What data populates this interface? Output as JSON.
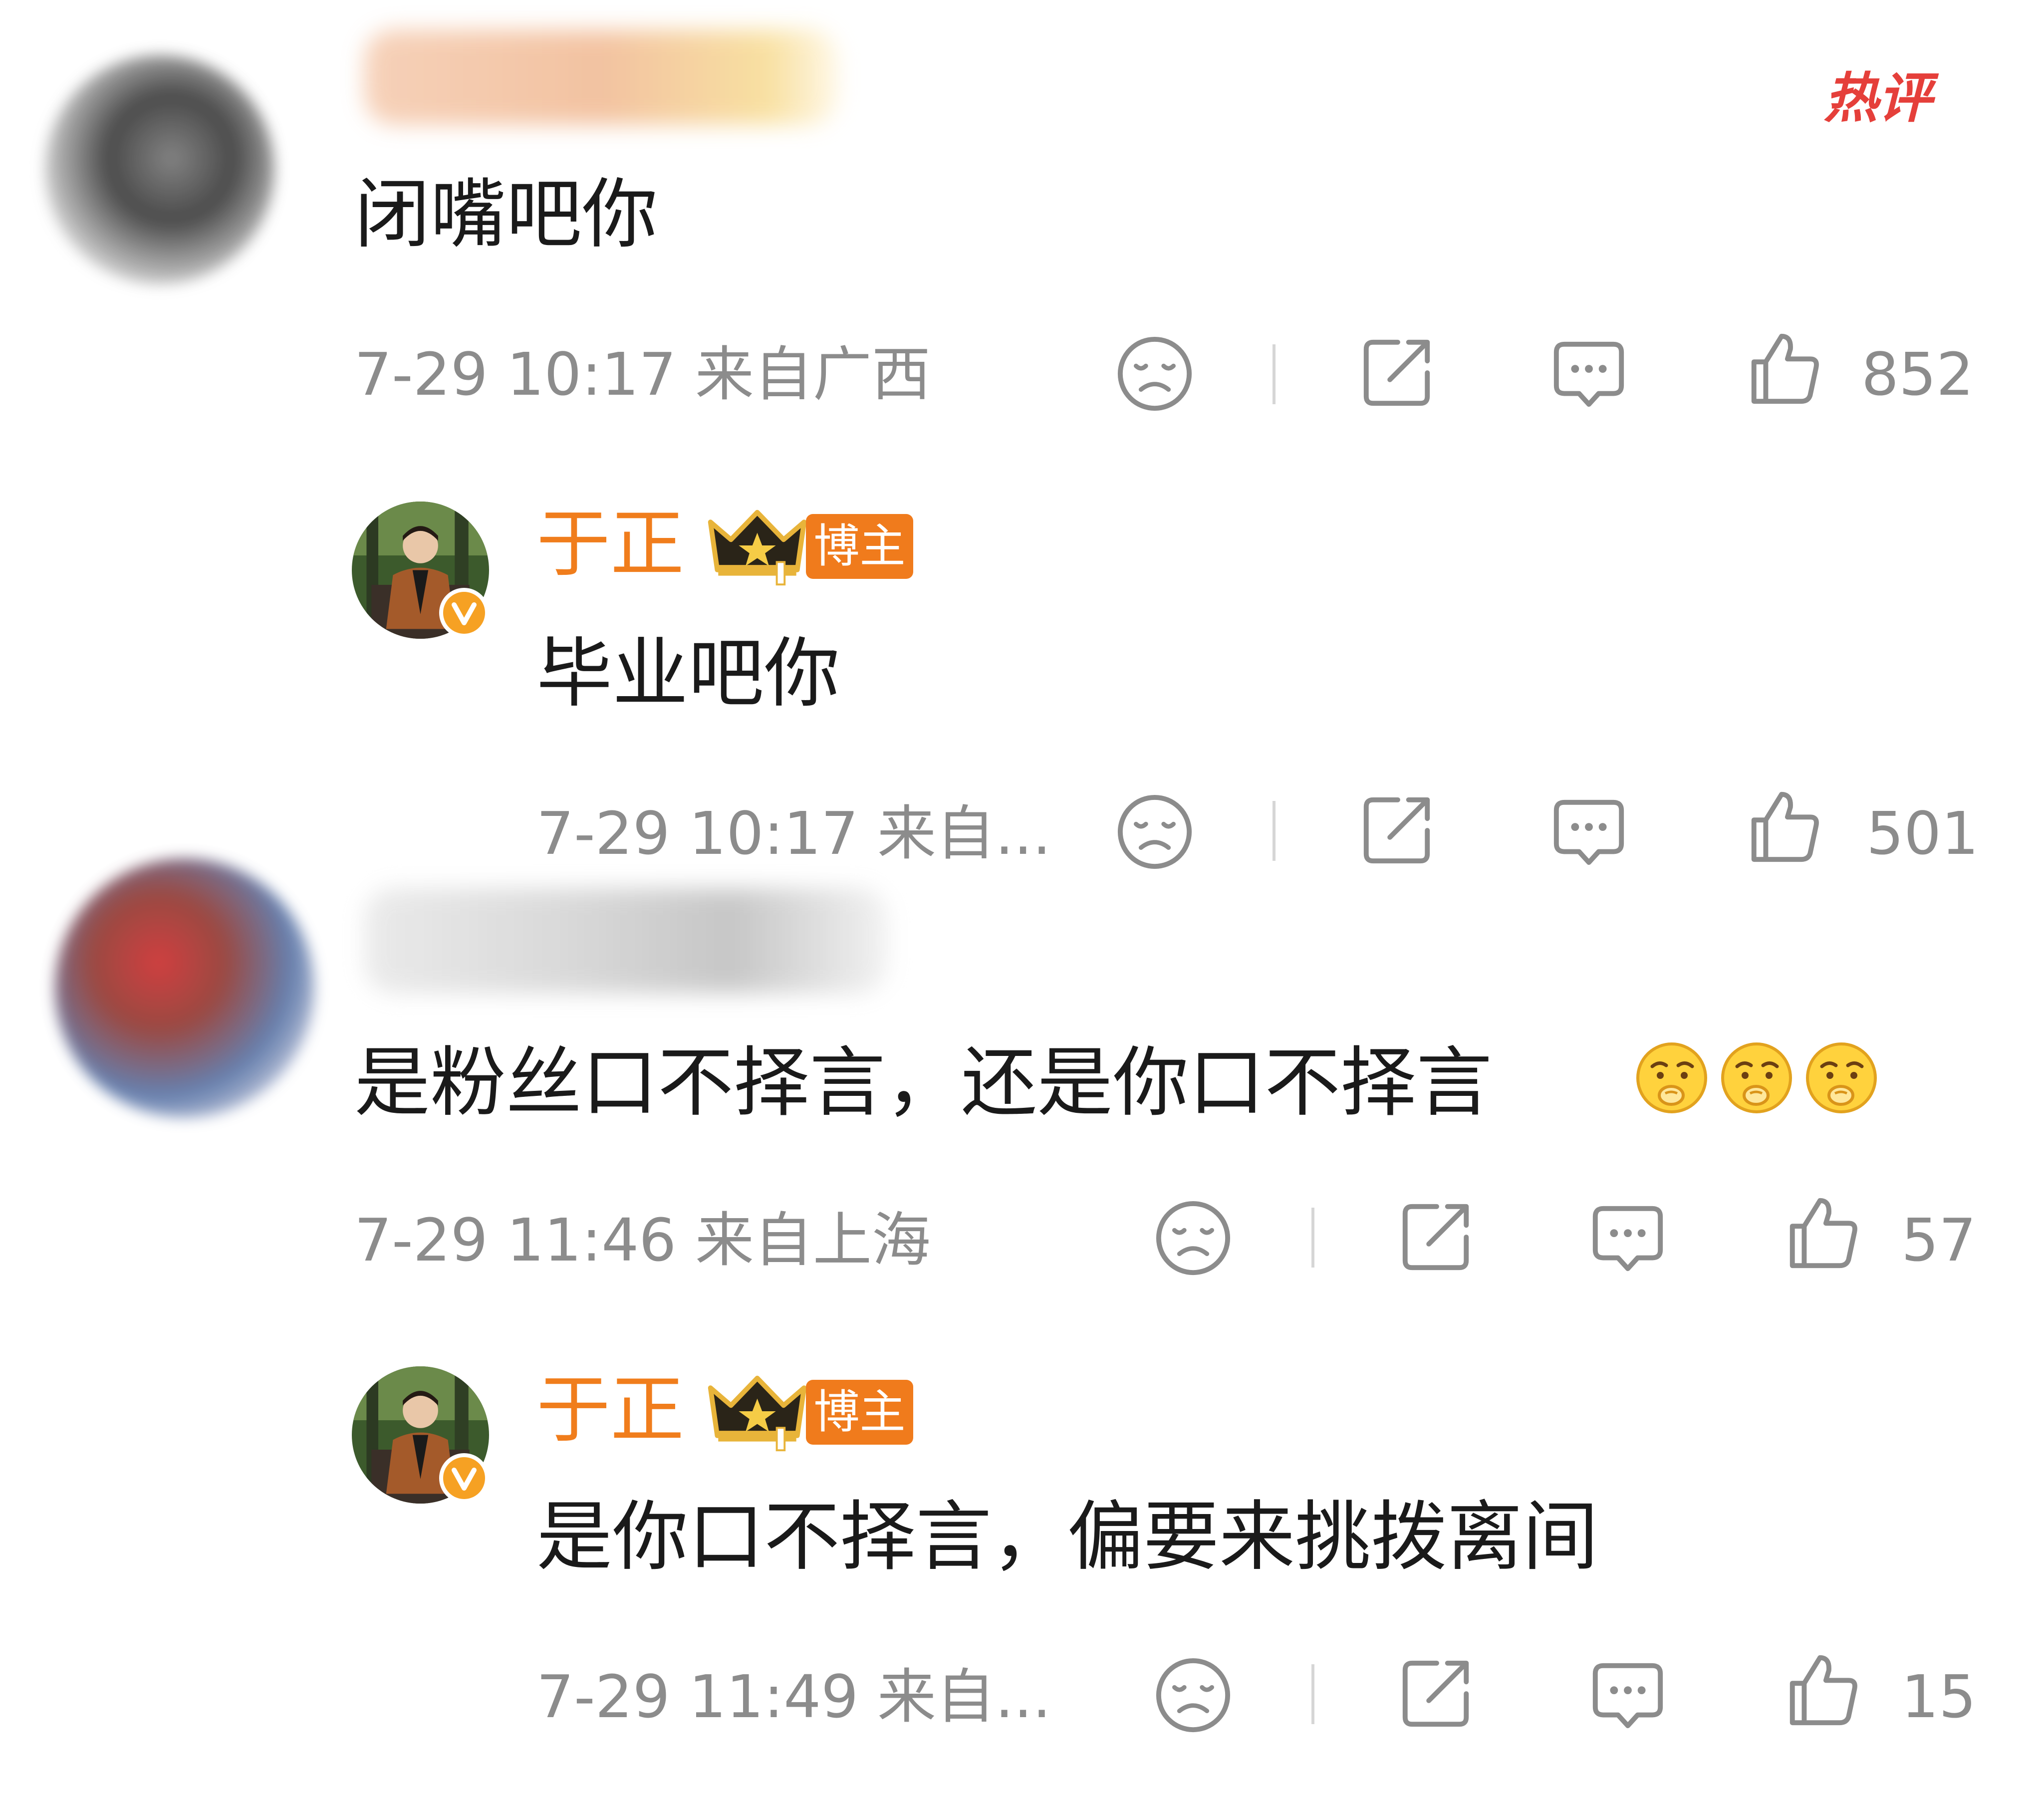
{
  "hot_tag": "热评",
  "comments": [
    {
      "text": "闭嘴吧你",
      "meta": "7-29 10:17 来自广西",
      "likes": "852"
    },
    {
      "author": "于正",
      "badge": "博主",
      "text": "毕业吧你",
      "meta": "7-29 10:17 来自...",
      "likes": "501"
    },
    {
      "text": "是粉丝口不择言，还是你口不择言",
      "meta": "7-29 11:46 来自上海",
      "likes": "57"
    },
    {
      "author": "于正",
      "badge": "博主",
      "text": "是你口不择言，偏要来挑拨离间",
      "meta": "7-29 11:49 来自...",
      "likes": "15"
    }
  ],
  "colors": {
    "author_name": "#f07d1c",
    "badge_bg": "#f07b1c",
    "hot_tag": "#e53f3a",
    "meta_text": "#8c8c8c",
    "comment_text": "#1a1a1a"
  },
  "icons": [
    "dislike-icon",
    "share-icon",
    "comment-icon",
    "like-icon",
    "crown-icon",
    "verified-icon",
    "blush-emoji"
  ]
}
